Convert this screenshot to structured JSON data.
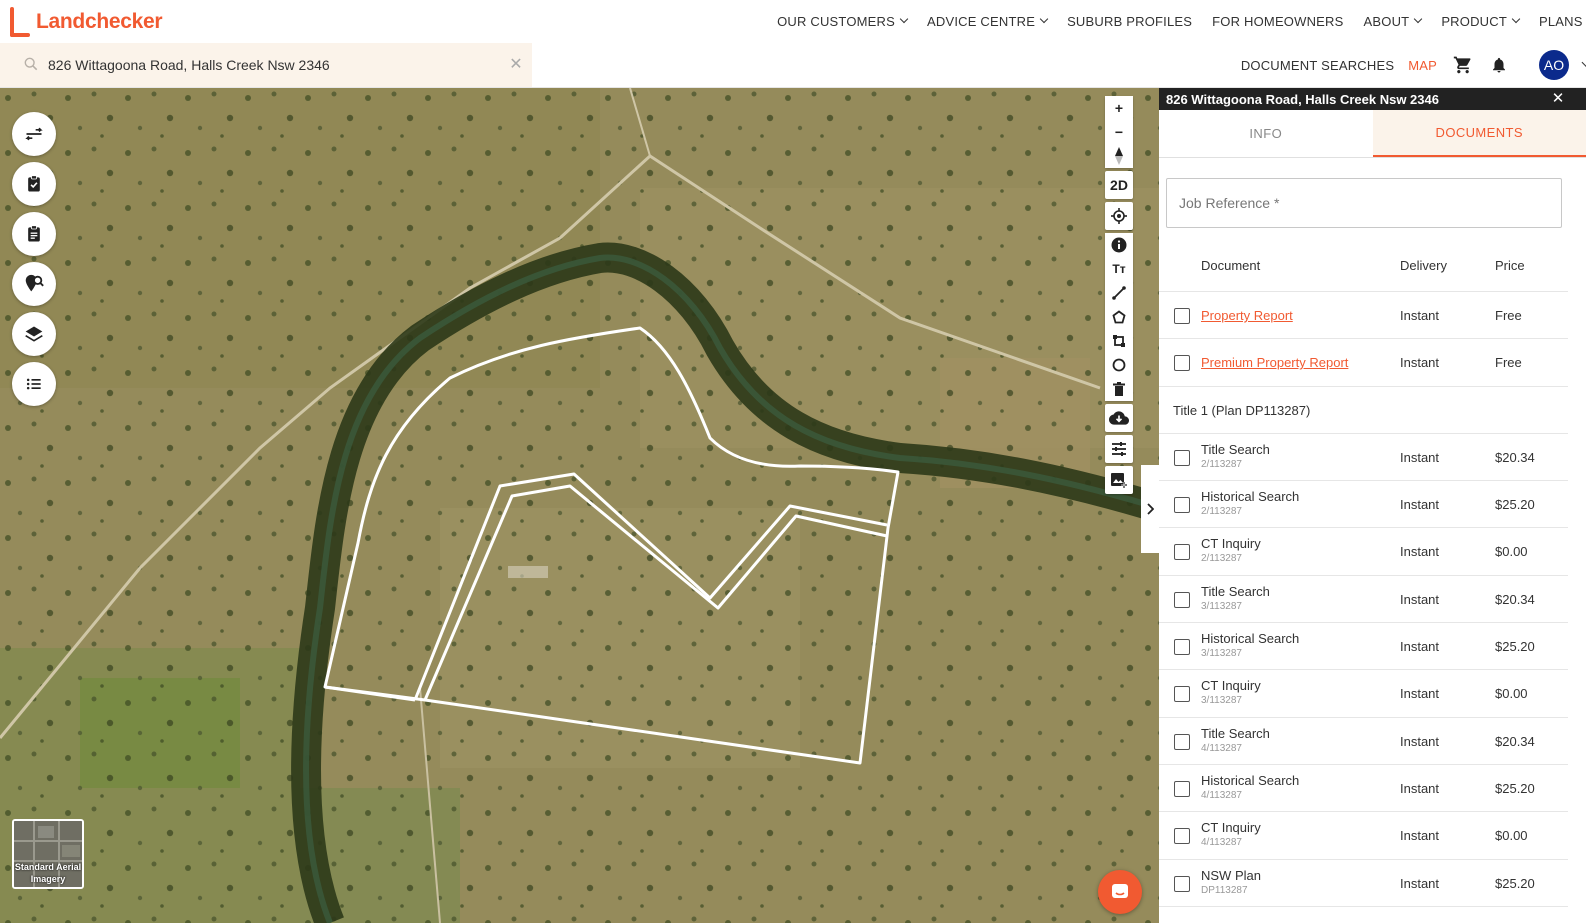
{
  "brand": {
    "name": "Landchecker",
    "accent": "#f15a31"
  },
  "nav": {
    "items": [
      {
        "label": "OUR CUSTOMERS",
        "dropdown": true
      },
      {
        "label": "ADVICE CENTRE",
        "dropdown": true
      },
      {
        "label": "SUBURB PROFILES",
        "dropdown": false
      },
      {
        "label": "FOR HOMEOWNERS",
        "dropdown": false
      },
      {
        "label": "ABOUT",
        "dropdown": true
      },
      {
        "label": "PRODUCT",
        "dropdown": true
      },
      {
        "label": "PLANS",
        "dropdown": false
      }
    ]
  },
  "search": {
    "value": "826 Wittagoona Road, Halls Creek Nsw 2346",
    "clear_icon": "close-icon"
  },
  "subnav": {
    "document_searches": "DOCUMENT SEARCHES",
    "map": "MAP",
    "cart_icon": "cart-icon",
    "bell_icon": "bell-icon",
    "avatar_initials": "AO"
  },
  "map": {
    "left_tools": [
      "compare-icon",
      "checklist-icon",
      "clipboard-icon",
      "location-search-icon",
      "layers-icon",
      "list-icon"
    ],
    "right_tools": [
      "zoom-in-icon",
      "zoom-out-icon",
      "compass-icon",
      "2D",
      "locate-icon",
      "info-icon",
      "text-icon",
      "ruler-icon",
      "polygon-icon",
      "rectangle-icon",
      "circle-icon",
      "trash-icon",
      "cloud-download-icon",
      "sliders-icon",
      "image-add-icon"
    ],
    "view_mode": "2D",
    "basemap_label": "Standard Aerial Imagery"
  },
  "panel": {
    "title": "826 Wittagoona Road, Halls Creek Nsw 2346",
    "tabs": {
      "info": "INFO",
      "documents": "DOCUMENTS",
      "active": "documents"
    },
    "job_reference_placeholder": "Job Reference *",
    "table": {
      "headers": {
        "document": "Document",
        "delivery": "Delivery",
        "price": "Price"
      },
      "rows": [
        {
          "name": "Property Report",
          "sub": "",
          "delivery": "Instant",
          "price": "Free",
          "link": true
        },
        {
          "name": "Premium Property Report",
          "sub": "",
          "delivery": "Instant",
          "price": "Free",
          "link": true
        }
      ],
      "section": "Title 1 (Plan DP113287)",
      "title_rows": [
        {
          "name": "Title Search",
          "sub": "2/113287",
          "delivery": "Instant",
          "price": "$20.34"
        },
        {
          "name": "Historical Search",
          "sub": "2/113287",
          "delivery": "Instant",
          "price": "$25.20"
        },
        {
          "name": "CT Inquiry",
          "sub": "2/113287",
          "delivery": "Instant",
          "price": "$0.00"
        },
        {
          "name": "Title Search",
          "sub": "3/113287",
          "delivery": "Instant",
          "price": "$20.34"
        },
        {
          "name": "Historical Search",
          "sub": "3/113287",
          "delivery": "Instant",
          "price": "$25.20"
        },
        {
          "name": "CT Inquiry",
          "sub": "3/113287",
          "delivery": "Instant",
          "price": "$0.00"
        },
        {
          "name": "Title Search",
          "sub": "4/113287",
          "delivery": "Instant",
          "price": "$20.34"
        },
        {
          "name": "Historical Search",
          "sub": "4/113287",
          "delivery": "Instant",
          "price": "$25.20"
        },
        {
          "name": "CT Inquiry",
          "sub": "4/113287",
          "delivery": "Instant",
          "price": "$0.00"
        },
        {
          "name": "NSW Plan",
          "sub": "DP113287",
          "delivery": "Instant",
          "price": "$25.20"
        }
      ]
    }
  }
}
